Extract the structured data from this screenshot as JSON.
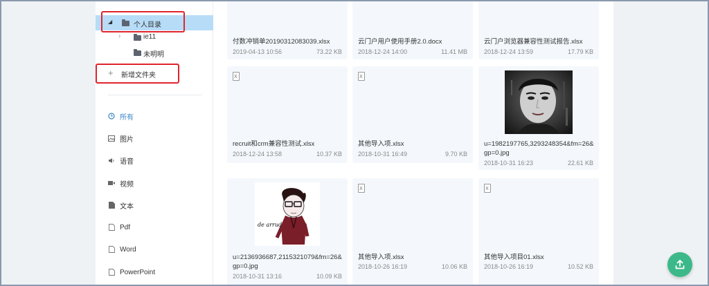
{
  "tree": {
    "root_label": "个人目录",
    "children": [
      {
        "label": "ie11"
      },
      {
        "label": "未明明"
      }
    ],
    "new_folder_label": "新增文件夹"
  },
  "nav": [
    {
      "label": "所有",
      "icon": "clock-icon",
      "active": true
    },
    {
      "label": "图片",
      "icon": "image-icon",
      "active": false
    },
    {
      "label": "语音",
      "icon": "speaker-icon",
      "active": false
    },
    {
      "label": "视频",
      "icon": "video-icon",
      "active": false
    },
    {
      "label": "文本",
      "icon": "document-icon",
      "active": false
    },
    {
      "label": "Pdf",
      "icon": "pdf-file-icon",
      "active": false
    },
    {
      "label": "Word",
      "icon": "word-file-icon",
      "active": false
    },
    {
      "label": "PowerPoint",
      "icon": "ppt-file-icon",
      "active": false
    }
  ],
  "files": [
    {
      "name": "付数冲销单20190312083039.xlsx",
      "date": "2019-04-13 10:56",
      "size": "73.22 KB",
      "type": "xlsx"
    },
    {
      "name": "云门户用户使用手册2.0.docx",
      "date": "2018-12-24 14:00",
      "size": "11.41 MB",
      "type": "docx"
    },
    {
      "name": "云门户浏览器兼容性测试报告.xlsx",
      "date": "2018-12-24 13:59",
      "size": "17.79 KB",
      "type": "xlsx"
    },
    {
      "name": "recruit和crm兼容性测试.xlsx",
      "date": "2018-12-24 13:58",
      "size": "10.37 KB",
      "type": "xlsx"
    },
    {
      "name": "其他导入项.xlsx",
      "date": "2018-10-31 16:49",
      "size": "9.70 KB",
      "type": "xlsx"
    },
    {
      "name": "u=1982197765,3293248354&fm=26&gp=0.jpg",
      "date": "2018-10-31 16:23",
      "size": "22.61 KB",
      "type": "jpg"
    },
    {
      "name": "u=2136936687,2115321079&fm=26&gp=0.jpg",
      "date": "2018-10-31 13:16",
      "size": "10.09 KB",
      "type": "jpg"
    },
    {
      "name": "其他导入项.xlsx",
      "date": "2018-10-26 16:19",
      "size": "10.06 KB",
      "type": "xlsx"
    },
    {
      "name": "其他导入项目01.xlsx",
      "date": "2018-10-26 16:19",
      "size": "10.52 KB",
      "type": "xlsx"
    }
  ],
  "thumb_text": {
    "sketch_caption": "de arrud"
  },
  "colors": {
    "accent": "#3a87c8",
    "selected_bg": "#b7dcf7",
    "highlight_box": "#e0242b",
    "upload_button": "#3db889",
    "card_bg": "#f4f8fc"
  }
}
